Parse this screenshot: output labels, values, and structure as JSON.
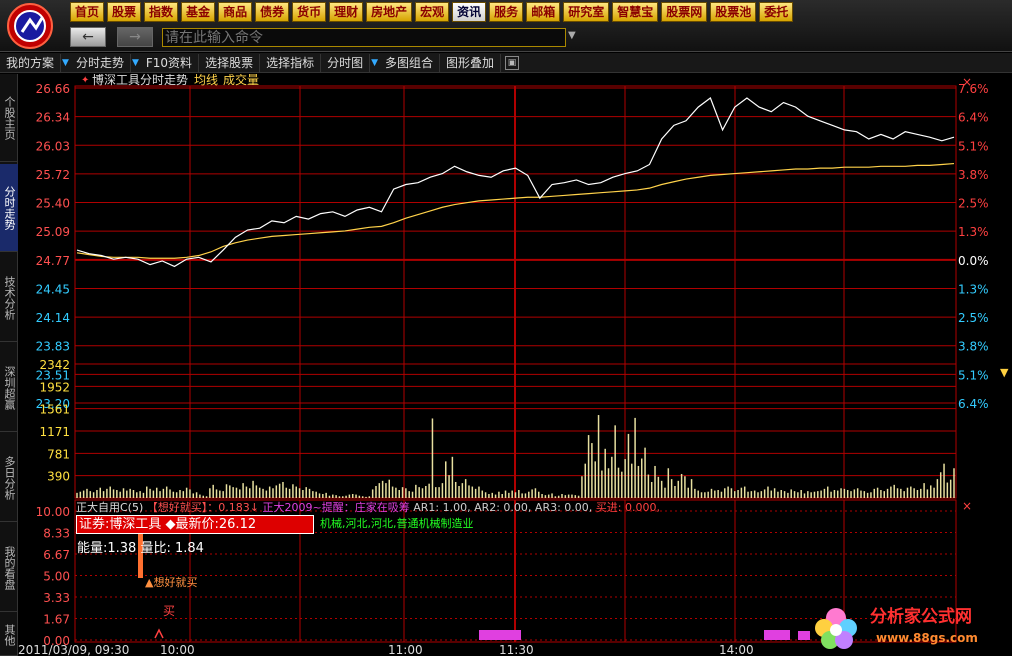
{
  "menu": [
    "首页",
    "股票",
    "指数",
    "基金",
    "商品",
    "债券",
    "货币",
    "理财",
    "房地产",
    "宏观",
    "资讯",
    "服务",
    "邮箱",
    "研究室",
    "智慧宝",
    "股票网",
    "股票池",
    "委托"
  ],
  "active_menu": "资讯",
  "command": {
    "placeholder": "请在此输入命令"
  },
  "toolbar": [
    "我的方案",
    "分时走势",
    "F10资料",
    "选择股票",
    "选择指标",
    "分时图",
    "多图组合",
    "图形叠加"
  ],
  "sidetabs": [
    "个股主页",
    "分时走势",
    "技术分析",
    "深圳超赢",
    "多日分析",
    "我的看盘",
    "其他"
  ],
  "chart_header": {
    "stock": "博深工具分时走势",
    "avg_label": "均线",
    "vol_label": "成交量"
  },
  "price_axis": [
    "26.66",
    "26.34",
    "26.03",
    "25.72",
    "25.40",
    "25.09",
    "24.77",
    "24.45",
    "24.14",
    "23.83",
    "23.51",
    "23.20"
  ],
  "pct_axis_up": [
    "7.6%",
    "6.4%",
    "5.1%",
    "3.8%",
    "2.5%",
    "1.3%",
    "0.0%"
  ],
  "pct_axis_down": [
    "1.3%",
    "2.5%",
    "3.8%",
    "5.1%",
    "6.4%"
  ],
  "vol_axis": [
    "2342",
    "1952",
    "1561",
    "1171",
    "781",
    "390"
  ],
  "ind_axis": [
    "10.00",
    "8.33",
    "6.67",
    "5.00",
    "3.33",
    "1.67",
    "0.00"
  ],
  "time_axis": [
    "2011/03/09, 09:30",
    "10:00",
    "11:00",
    "11:30",
    "14:00"
  ],
  "indicator": {
    "name": "正大自用C(5)",
    "signal": "【想好就买】：0.183↓",
    "alert": "正大2009~提醒：庄家在吸筹",
    "ar1": "AR1: 1.00,",
    "ar2": "AR2: 0.00,",
    "ar3": "AR3: 0.00,",
    "buy_in": "买进: 0.000,"
  },
  "stock_box": "证券:博深工具 ◆最新价:26.12",
  "industry": "机械,河北,河北,普通机械制造业",
  "energy": "能量:1.38  量比: 1.84",
  "signal_buy": "▲想好就买",
  "mark_buy": "买",
  "watermark": {
    "title": "分析家公式网",
    "url": "www.88gs.com"
  },
  "colors": {
    "grid": "#b00000",
    "price": "#ffffff",
    "avg": "#ffd24a",
    "volume": "#e8e0a0",
    "up_axis": "#ff4040",
    "down_axis": "#33ccff",
    "magenta": "#e040e0"
  },
  "chart_data": {
    "type": "line",
    "price_range": [
      23.2,
      26.66
    ],
    "prev_close": 24.77,
    "price": [
      24.88,
      24.84,
      24.82,
      24.78,
      24.8,
      24.78,
      24.72,
      24.76,
      24.7,
      24.78,
      24.8,
      24.75,
      24.88,
      25.02,
      25.1,
      25.12,
      25.2,
      25.18,
      25.25,
      25.22,
      25.28,
      25.3,
      25.25,
      25.32,
      25.35,
      25.3,
      25.55,
      25.6,
      25.62,
      25.68,
      25.72,
      25.8,
      25.74,
      25.7,
      25.68,
      25.75,
      25.78,
      25.7,
      25.45,
      25.6,
      25.62,
      25.65,
      25.6,
      25.62,
      25.68,
      25.72,
      25.75,
      25.82,
      26.1,
      26.25,
      26.3,
      26.45,
      26.55,
      26.2,
      26.45,
      26.55,
      26.45,
      26.4,
      26.5,
      26.45,
      26.35,
      26.3,
      26.25,
      26.2,
      26.18,
      26.1,
      26.15,
      26.1,
      26.18,
      26.15,
      26.12,
      26.08,
      26.12
    ],
    "avg": [
      24.85,
      24.83,
      24.81,
      24.8,
      24.8,
      24.8,
      24.79,
      24.79,
      24.79,
      24.8,
      24.82,
      24.86,
      24.92,
      24.96,
      24.99,
      25.01,
      25.03,
      25.04,
      25.05,
      25.06,
      25.07,
      25.08,
      25.09,
      25.11,
      25.13,
      25.14,
      25.18,
      25.23,
      25.27,
      25.31,
      25.35,
      25.38,
      25.4,
      25.42,
      25.43,
      25.44,
      25.45,
      25.46,
      25.46,
      25.47,
      25.48,
      25.49,
      25.5,
      25.51,
      25.52,
      25.53,
      25.54,
      25.56,
      25.6,
      25.63,
      25.66,
      25.68,
      25.7,
      25.71,
      25.72,
      25.73,
      25.74,
      25.75,
      25.76,
      25.77,
      25.77,
      25.78,
      25.78,
      25.79,
      25.79,
      25.79,
      25.8,
      25.8,
      25.8,
      25.81,
      25.81,
      25.82,
      25.83
    ],
    "volume_range": [
      0,
      2342
    ],
    "volume": [
      90,
      110,
      130,
      160,
      120,
      100,
      140,
      180,
      120,
      160,
      200,
      150,
      140,
      110,
      170,
      130,
      160,
      140,
      100,
      120,
      90,
      200,
      160,
      130,
      180,
      120,
      160,
      200,
      150,
      110,
      100,
      140,
      120,
      180,
      150,
      80,
      100,
      60,
      40,
      30,
      170,
      230,
      150,
      130,
      120,
      240,
      220,
      190,
      180,
      150,
      260,
      200,
      170,
      300,
      220,
      180,
      160,
      130,
      200,
      170,
      220,
      250,
      280,
      180,
      160,
      240,
      200,
      170,
      140,
      190,
      160,
      120,
      110,
      80,
      70,
      90,
      40,
      60,
      50,
      30,
      30,
      40,
      60,
      70,
      60,
      40,
      30,
      20,
      30,
      150,
      210,
      260,
      300,
      260,
      320,
      200,
      180,
      140,
      190,
      170,
      120,
      110,
      230,
      190,
      170,
      210,
      250,
      1390,
      190,
      190,
      260,
      640,
      400,
      720,
      280,
      210,
      260,
      330,
      220,
      200,
      160,
      200,
      130,
      100,
      70,
      90,
      60,
      110,
      70,
      130,
      90,
      130,
      100,
      140,
      80,
      80,
      110,
      150,
      170,
      110,
      70,
      50,
      60,
      80,
      30,
      40,
      70,
      50,
      60,
      60,
      50,
      40,
      380,
      600,
      1100,
      960,
      640,
      1450,
      480,
      860,
      520,
      720,
      1270,
      530,
      460,
      680,
      1120,
      600,
      1400,
      560,
      690,
      880,
      410,
      280,
      560,
      370,
      300,
      180,
      520,
      330,
      210,
      300,
      420,
      380,
      180,
      330,
      160,
      130,
      100,
      100,
      110,
      160,
      130,
      140,
      110,
      170,
      200,
      170,
      120,
      140,
      180,
      200,
      110,
      120,
      130,
      100,
      120,
      150,
      200,
      130,
      170,
      110,
      140,
      120,
      90,
      150,
      120,
      100,
      140,
      80,
      120,
      100,
      110,
      120,
      130,
      160,
      200,
      110,
      140,
      130,
      170,
      160,
      140,
      120,
      150,
      170,
      130,
      120,
      90,
      100,
      160,
      180,
      140,
      120,
      160,
      200,
      230,
      170,
      160,
      120,
      180,
      200,
      170,
      140,
      160,
      260,
      150,
      220,
      180,
      330,
      450,
      600,
      270,
      320,
      520
    ]
  }
}
